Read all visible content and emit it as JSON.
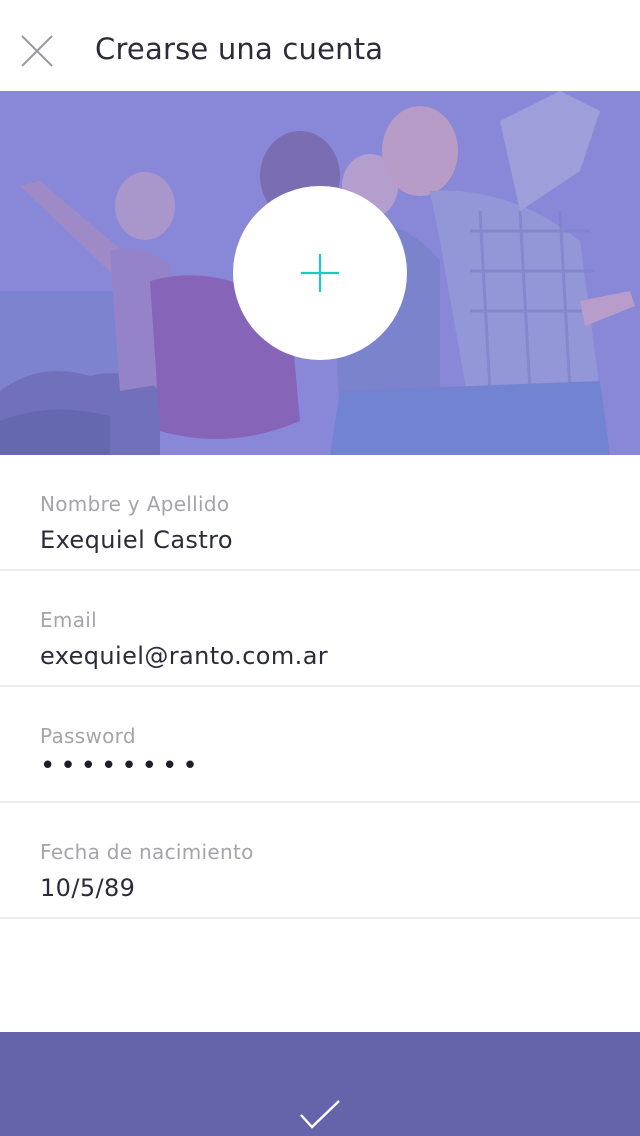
{
  "header": {
    "title": "Crearse una cuenta",
    "close_icon": "close-icon"
  },
  "hero": {
    "image": "group-of-friends-photo",
    "overlay_color": "#8a88d8",
    "add_photo_icon": "plus-icon",
    "add_photo_icon_color": "#1fc9c0"
  },
  "form": {
    "fields": [
      {
        "label": "Nombre y Apellido",
        "value": "Exequiel Castro"
      },
      {
        "label": "Email",
        "value": "exequiel@ranto.com.ar"
      },
      {
        "label": "Password",
        "value": "••••••••"
      },
      {
        "label": "Fecha de nacimiento",
        "value": "10/5/89"
      }
    ]
  },
  "footer": {
    "confirm_icon": "checkmark-icon",
    "background_color": "#6563a9"
  }
}
